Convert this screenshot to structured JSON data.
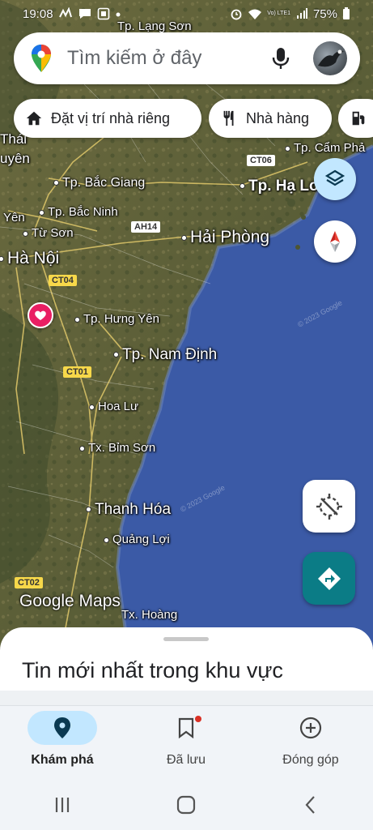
{
  "status_bar": {
    "time": "19:08",
    "left_icons": [
      "notification-icon",
      "chat-icon",
      "screenshot-icon",
      "dot-icon"
    ],
    "right_icons": [
      "alarm-icon",
      "wifi-icon",
      "volte-icon",
      "signal-icon"
    ],
    "volte_label": "Vo) LTE1",
    "battery": "75%"
  },
  "search": {
    "placeholder": "Tìm kiếm ở đây",
    "icons": [
      "maps-pin-icon",
      "mic-icon"
    ],
    "avatar": "profile-avatar"
  },
  "chips": [
    {
      "label": "Đặt vị trí nhà riêng",
      "icon": "home-icon"
    },
    {
      "label": "Nhà hàng",
      "icon": "restaurant-icon"
    },
    {
      "label": "",
      "icon": "gas-station-icon"
    }
  ],
  "map": {
    "places": [
      {
        "label": "Tp. Lạng Sơn"
      },
      {
        "label": "Thái"
      },
      {
        "label": "uyên"
      },
      {
        "label": "Tp. Cẩm Phả"
      },
      {
        "label": "Tp. Bắc Giang"
      },
      {
        "label": "Tp. Hạ Lo"
      },
      {
        "label": "Yên"
      },
      {
        "label": "Tp. Bắc Ninh"
      },
      {
        "label": "Từ Sơn"
      },
      {
        "label": "Hải Phòng"
      },
      {
        "label": "Hà Nội"
      },
      {
        "label": "Tp. Hưng Yên"
      },
      {
        "label": "Tp. Nam Định"
      },
      {
        "label": "Hoa Lư"
      },
      {
        "label": "Tx. Bỉm Sơn"
      },
      {
        "label": "Thanh Hóa"
      },
      {
        "label": "Quảng Lợi"
      },
      {
        "label": "Tx. Hoàng"
      }
    ],
    "roads": [
      "CT06",
      "AH14",
      "CT04",
      "CT01",
      "CT02"
    ],
    "copyrights": [
      "© 2023 Google",
      "© 2023 Google"
    ],
    "logo": "Google Maps"
  },
  "colors": {
    "accent_blue": "#c2e7ff",
    "directions_teal": "#0b7c86",
    "sea": "#3b5aa6",
    "layers_bg": "#c2e7ff",
    "saved_dot": "#d93025",
    "favorite_pink": "#e91e63"
  },
  "sheet": {
    "title": "Tin mới nhất trong khu vực"
  },
  "bottom_nav": [
    {
      "label": "Khám phá",
      "icon": "explore-pin-icon",
      "active": true
    },
    {
      "label": "Đã lưu",
      "icon": "bookmark-icon",
      "active": false
    },
    {
      "label": "Đóng góp",
      "icon": "add-circle-icon",
      "active": false
    }
  ],
  "system_nav": [
    "recents-icon",
    "home-icon",
    "back-icon"
  ]
}
